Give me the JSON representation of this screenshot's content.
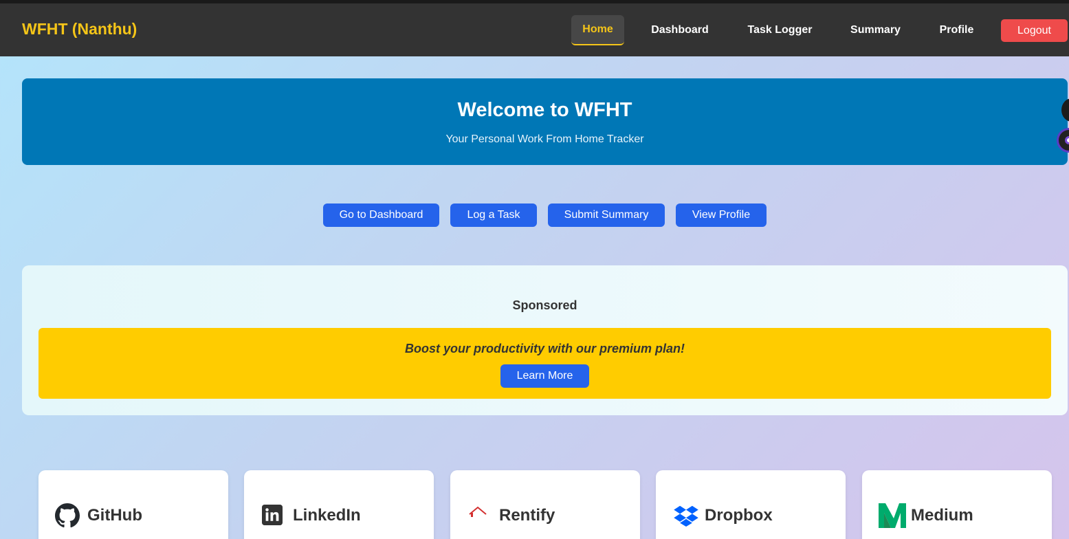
{
  "navbar": {
    "brand": "WFHT (Nanthu)",
    "links": [
      "Home",
      "Dashboard",
      "Task Logger",
      "Summary",
      "Profile"
    ],
    "logout": "Logout",
    "active": "Home",
    "active_color": "#f5c518"
  },
  "hero": {
    "title": "Welcome to WFHT",
    "subtitle": "Your Personal Work From Home Tracker",
    "color": "#0077b6"
  },
  "actions": [
    "Go to Dashboard",
    "Log a Task",
    "Submit Summary",
    "View Profile"
  ],
  "sponsored": {
    "title": "Sponsored",
    "promo_text": "Boost your productivity with our premium plan!",
    "button": "Learn More",
    "promo_color": "#ffcc00"
  },
  "cards": [
    {
      "name": "GitHub",
      "icon": "github-icon"
    },
    {
      "name": "LinkedIn",
      "icon": "linkedin-icon"
    },
    {
      "name": "Rentify",
      "icon": "rentify-logo"
    },
    {
      "name": "Dropbox",
      "icon": "dropbox-icon"
    },
    {
      "name": "Medium",
      "icon": "medium-icon"
    }
  ],
  "colors": {
    "button": "#2563eb",
    "logout": "#ef4b4b",
    "navbar": "#333333"
  }
}
